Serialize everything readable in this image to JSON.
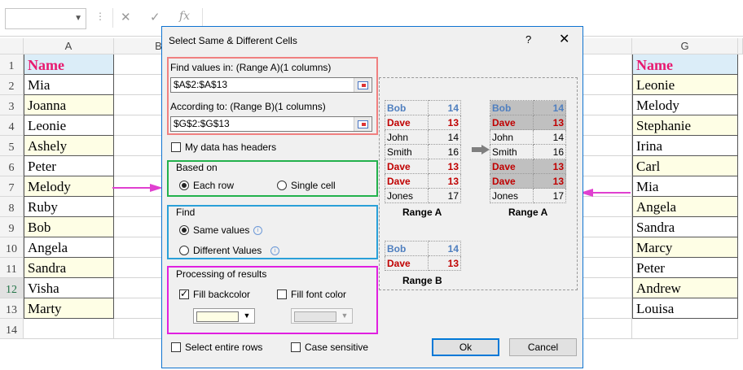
{
  "formula_bar": {
    "name_box": "",
    "formula": ""
  },
  "columns": {
    "a": "A",
    "b": "B",
    "g": "G"
  },
  "rows": [
    "1",
    "2",
    "3",
    "4",
    "5",
    "6",
    "7",
    "8",
    "9",
    "10",
    "11",
    "12",
    "13",
    "14"
  ],
  "col_a": [
    "Name",
    "Mia",
    "Joanna",
    "Leonie",
    "Ashely",
    "Peter",
    "Melody",
    "Ruby",
    "Bob",
    "Angela",
    "Sandra",
    "Visha",
    "Marty"
  ],
  "col_g": [
    "Name",
    "Leonie",
    "Melody",
    "Stephanie",
    "Irina",
    "Carl",
    "Mia",
    "Angela",
    "Sandra",
    "Marcy",
    "Peter",
    "Andrew",
    "Louisa"
  ],
  "colors": {
    "header_fill": "#dbedf8",
    "header_text": "#e8196f",
    "alt_fill": "#fefee5",
    "arrow": "#e040d0",
    "accent": "#0078d7"
  },
  "dialog": {
    "title": "Select Same & Different Cells",
    "help": "?",
    "close": "✕",
    "range_a_label": "Find values in: (Range A)(1 columns)",
    "range_a_value": "$A$2:$A$13",
    "range_b_label": "According to: (Range B)(1 columns)",
    "range_b_value": "$G$2:$G$13",
    "headers_label": "My data has headers",
    "based_on": {
      "legend": "Based on",
      "each_row": "Each row",
      "single_cell": "Single cell"
    },
    "find": {
      "legend": "Find",
      "same": "Same values",
      "different": "Different Values"
    },
    "processing": {
      "legend": "Processing of results",
      "fill_back": "Fill backcolor",
      "fill_font": "Fill font color"
    },
    "select_entire_rows": "Select entire rows",
    "case_sensitive": "Case sensitive",
    "ok": "Ok",
    "cancel": "Cancel",
    "preview": {
      "left_table": [
        [
          "Bob",
          "14"
        ],
        [
          "Dave",
          "13"
        ],
        [
          "John",
          "14"
        ],
        [
          "Smith",
          "16"
        ],
        [
          "Dave",
          "13"
        ],
        [
          "Dave",
          "13"
        ],
        [
          "Jones",
          "17"
        ]
      ],
      "right_table": [
        [
          "Bob",
          "14"
        ],
        [
          "Dave",
          "13"
        ],
        [
          "John",
          "14"
        ],
        [
          "Smith",
          "16"
        ],
        [
          "Dave",
          "13"
        ],
        [
          "Dave",
          "13"
        ],
        [
          "Jones",
          "17"
        ]
      ],
      "bottom_table": [
        [
          "Bob",
          "14"
        ],
        [
          "Dave",
          "13"
        ]
      ],
      "caption_a_left": "Range A",
      "caption_a_right": "Range A",
      "caption_b": "Range B"
    },
    "frame_colors": {
      "range": "#f08080",
      "based_on": "#22b14c",
      "find": "#2aa0d8",
      "processing": "#e020e0"
    }
  },
  "icons": [
    "dropdown-arrow-icon",
    "cancel-x-icon",
    "enter-check-icon",
    "function-fx-icon",
    "range-select-icon",
    "info-icon",
    "grey-arrow-icon",
    "magenta-arrow-icon"
  ]
}
